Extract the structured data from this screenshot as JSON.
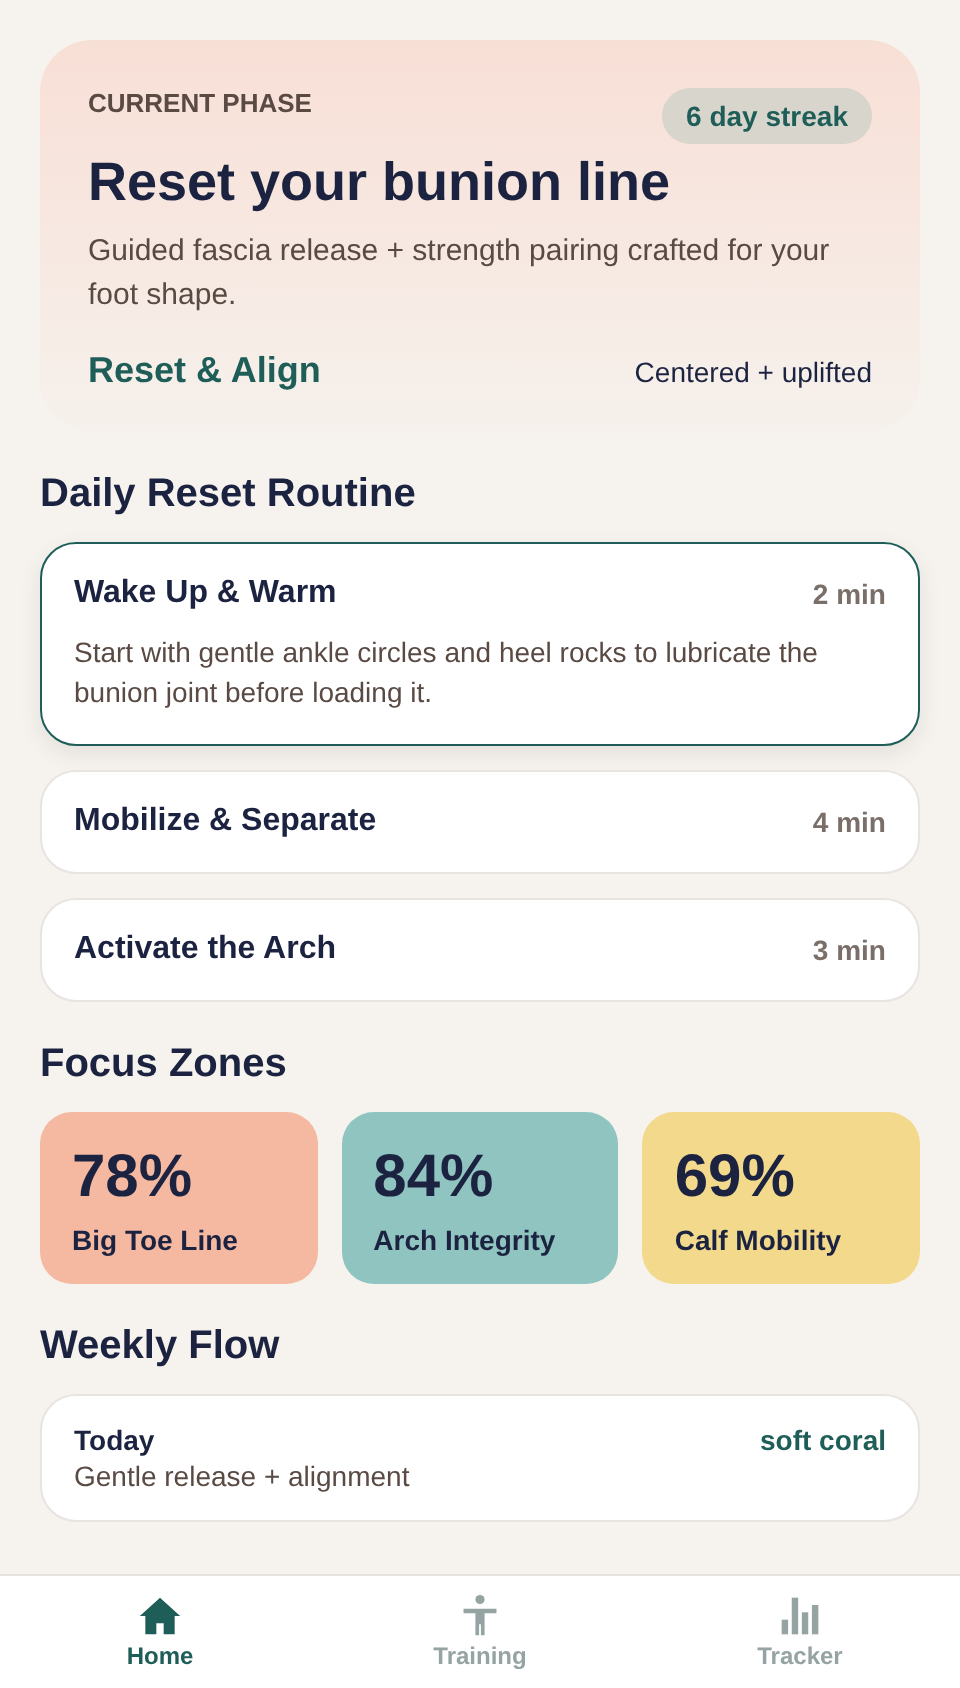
{
  "hero": {
    "eyebrow": "CURRENT PHASE",
    "streak": "6 day streak",
    "title": "Reset your bunion line",
    "description": "Guided fascia release + strength pairing crafted for your foot shape.",
    "program": "Reset & Align",
    "note": "Centered + uplifted"
  },
  "routine": {
    "heading": "Daily Reset Routine",
    "items": [
      {
        "title": "Wake Up & Warm",
        "duration": "2 min",
        "expanded": true,
        "description": "Start with gentle ankle circles and heel rocks to lubricate the bunion joint before loading it."
      },
      {
        "title": "Mobilize & Separate",
        "duration": "4 min",
        "expanded": false
      },
      {
        "title": "Activate the Arch",
        "duration": "3 min",
        "expanded": false
      }
    ]
  },
  "focus": {
    "heading": "Focus Zones",
    "zones": [
      {
        "value": "78%",
        "label": "Big Toe Line",
        "color": "#f5b8a0"
      },
      {
        "value": "84%",
        "label": "Arch Integrity",
        "color": "#8fc4c0"
      },
      {
        "value": "69%",
        "label": "Calf Mobility",
        "color": "#f3d98c"
      }
    ]
  },
  "weekly": {
    "heading": "Weekly Flow",
    "days": [
      {
        "day": "Today",
        "tone": "soft coral",
        "plan": "Gentle release + alignment"
      }
    ]
  },
  "tabs": [
    {
      "label": "Home",
      "kind": "home",
      "selected": true
    },
    {
      "label": "Training",
      "kind": "figure",
      "selected": false
    },
    {
      "label": "Tracker",
      "kind": "bars",
      "selected": false
    }
  ]
}
